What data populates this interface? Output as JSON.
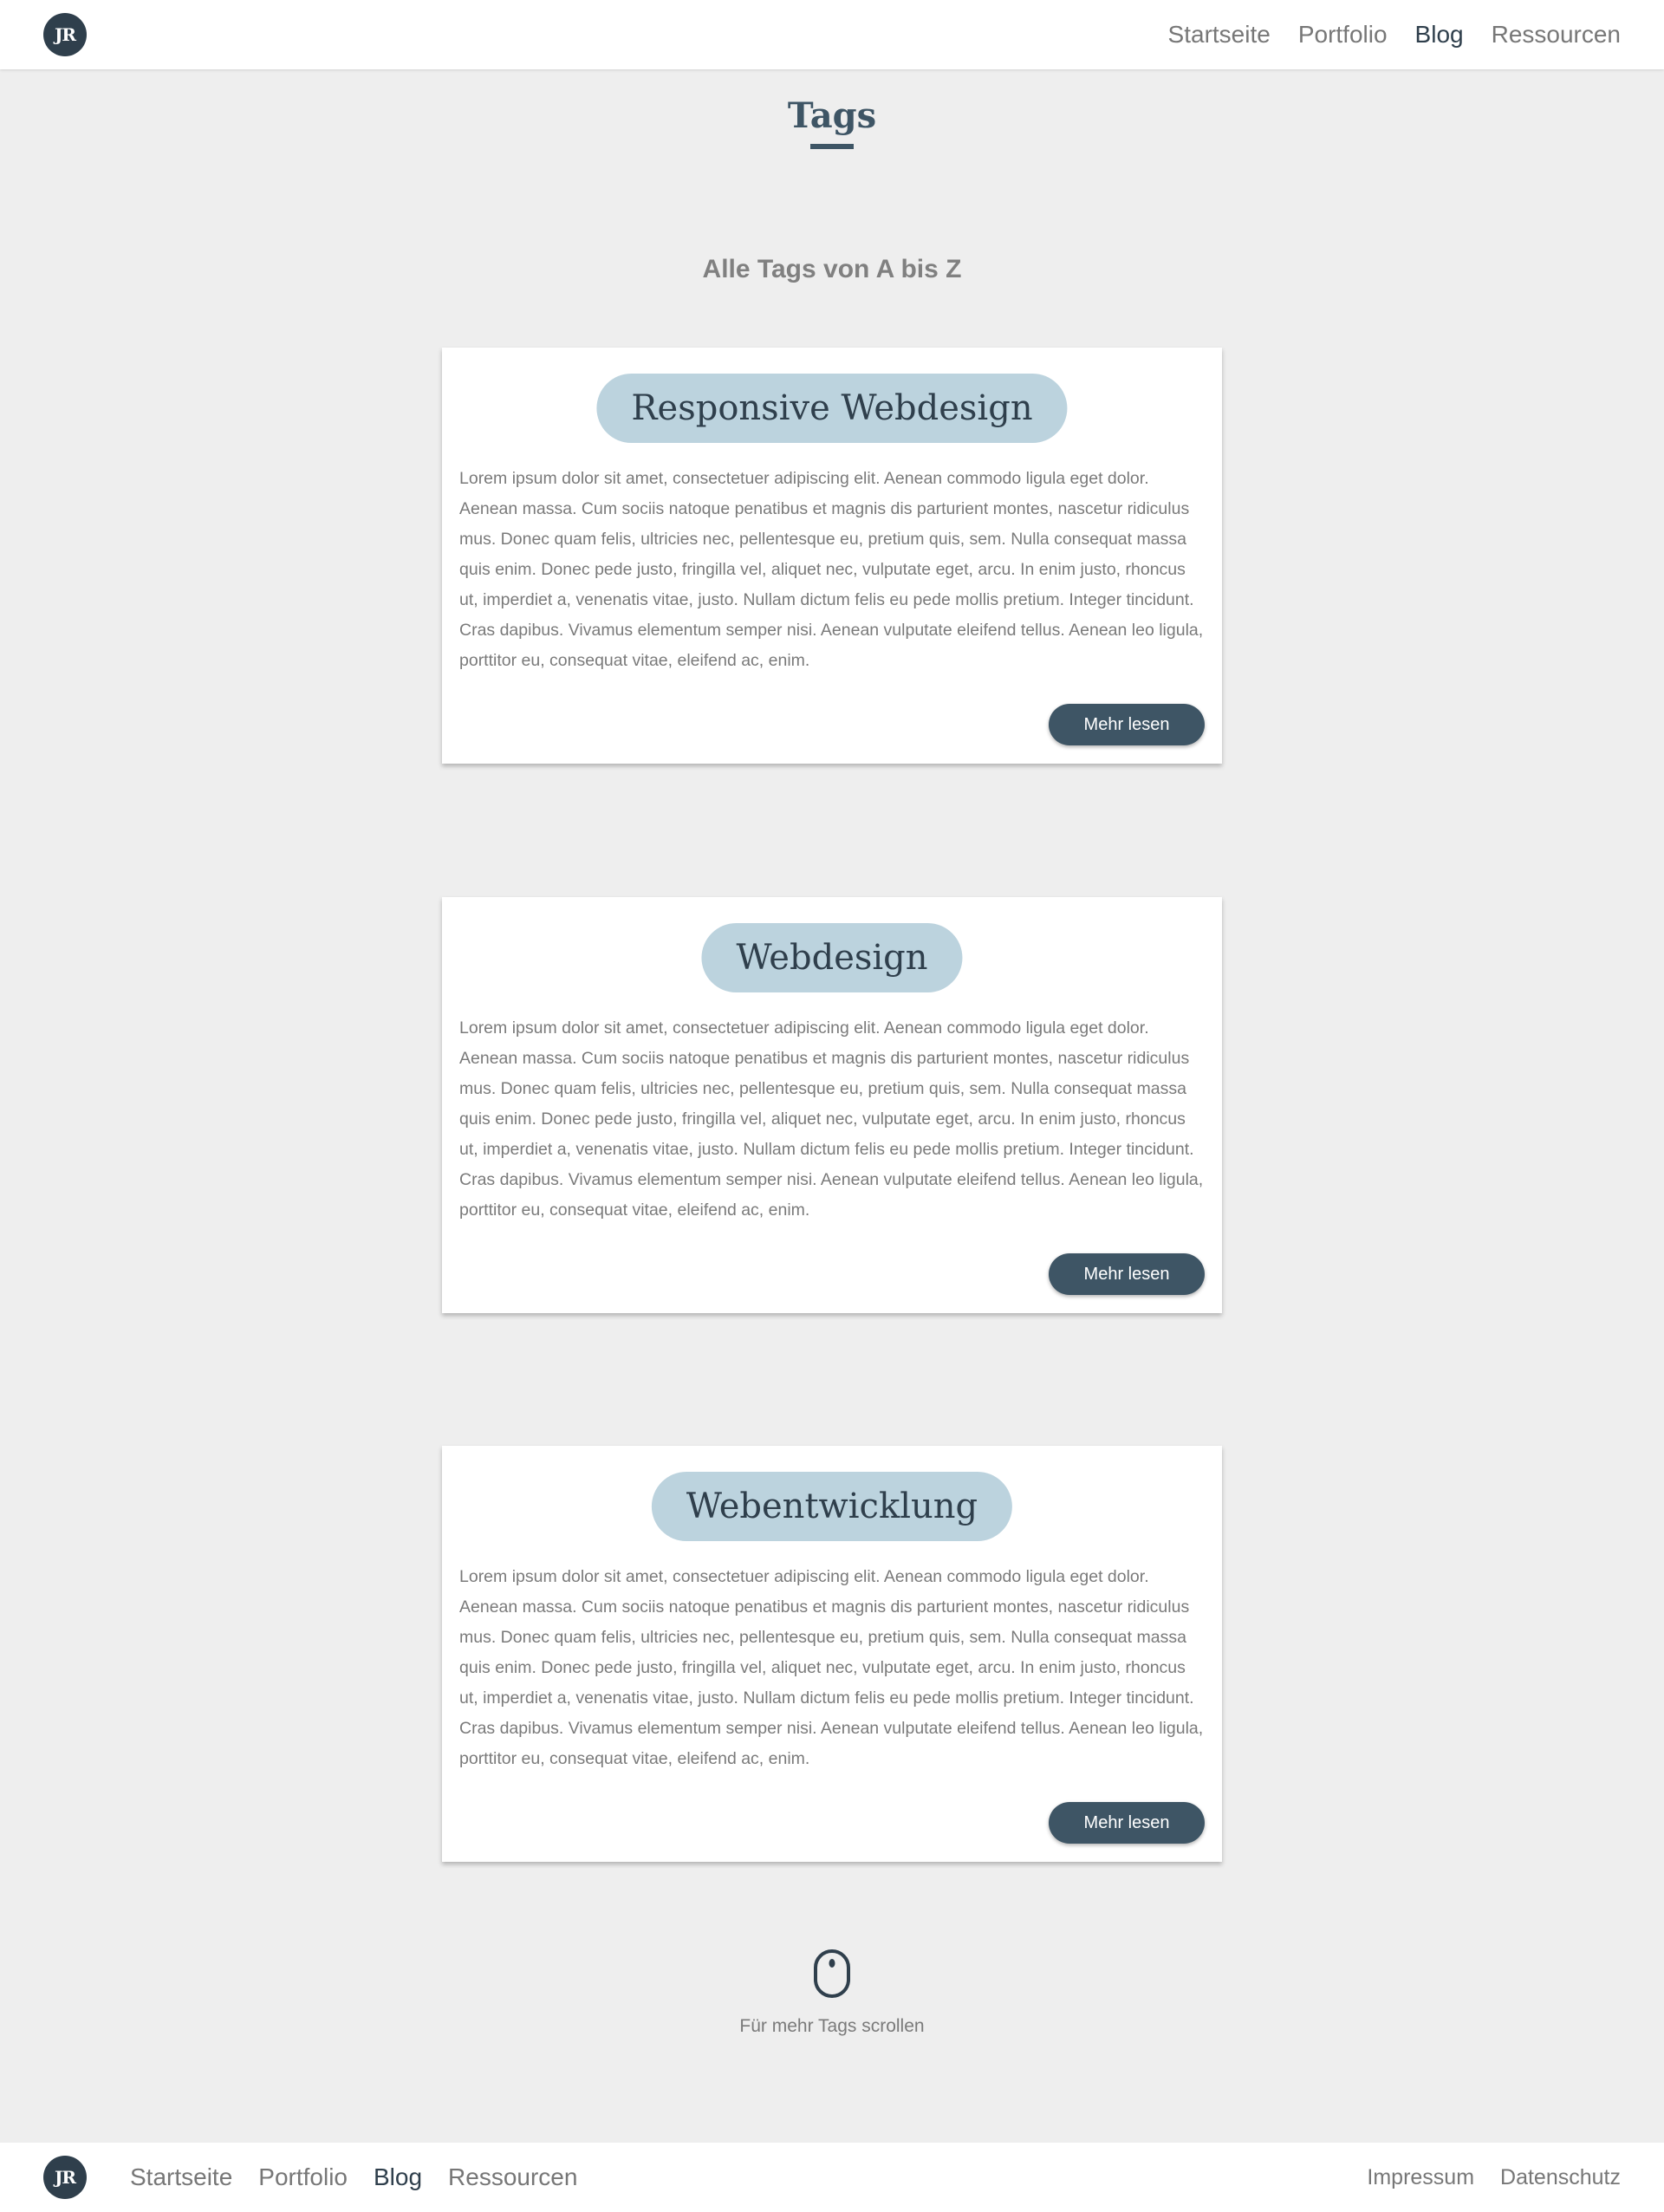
{
  "header": {
    "logo_text": "JR",
    "nav": [
      {
        "label": "Startseite"
      },
      {
        "label": "Portfolio"
      },
      {
        "label": "Blog"
      },
      {
        "label": "Ressourcen"
      }
    ],
    "active_nav": "Blog"
  },
  "page": {
    "title": "Tags",
    "subtitle": "Alle Tags von A bis Z"
  },
  "cards": [
    {
      "tag": "Responsive Webdesign",
      "excerpt": "Lorem ipsum dolor sit amet, consectetuer adipiscing elit. Aenean commodo ligula eget dolor. Aenean massa. Cum sociis natoque penatibus et magnis dis parturient montes, nascetur ridiculus mus. Donec quam felis, ultricies nec, pellentesque eu, pretium quis, sem. Nulla consequat massa quis enim. Donec pede justo, fringilla vel, aliquet nec, vulputate eget, arcu. In enim justo, rhoncus ut, imperdiet a, venenatis vitae, justo. Nullam dictum felis eu pede mollis pretium. Integer tincidunt. Cras dapibus. Vivamus elementum semper nisi. Aenean vulputate eleifend tellus. Aenean leo ligula, porttitor eu, consequat vitae, eleifend ac, enim.",
      "button": "Mehr lesen"
    },
    {
      "tag": "Webdesign",
      "excerpt": "Lorem ipsum dolor sit amet, consectetuer adipiscing elit. Aenean commodo ligula eget dolor. Aenean massa. Cum sociis natoque penatibus et magnis dis parturient montes, nascetur ridiculus mus. Donec quam felis, ultricies nec, pellentesque eu, pretium quis, sem. Nulla consequat massa quis enim. Donec pede justo, fringilla vel, aliquet nec, vulputate eget, arcu. In enim justo, rhoncus ut, imperdiet a, venenatis vitae, justo. Nullam dictum felis eu pede mollis pretium. Integer tincidunt. Cras dapibus. Vivamus elementum semper nisi. Aenean vulputate eleifend tellus. Aenean leo ligula, porttitor eu, consequat vitae, eleifend ac, enim.",
      "button": "Mehr lesen"
    },
    {
      "tag": "Webentwicklung",
      "excerpt": "Lorem ipsum dolor sit amet, consectetuer adipiscing elit. Aenean commodo ligula eget dolor. Aenean massa. Cum sociis natoque penatibus et magnis dis parturient montes, nascetur ridiculus mus. Donec quam felis, ultricies nec, pellentesque eu, pretium quis, sem. Nulla consequat massa quis enim. Donec pede justo, fringilla vel, aliquet nec, vulputate eget, arcu. In enim justo, rhoncus ut, imperdiet a, venenatis vitae, justo. Nullam dictum felis eu pede mollis pretium. Integer tincidunt. Cras dapibus. Vivamus elementum semper nisi. Aenean vulputate eleifend tellus. Aenean leo ligula, porttitor eu, consequat vitae, eleifend ac, enim.",
      "button": "Mehr lesen"
    }
  ],
  "scroll_hint": {
    "icon": "mouse-icon",
    "text": "Für mehr Tags scrollen"
  },
  "footer": {
    "logo_text": "JR",
    "nav": [
      {
        "label": "Startseite"
      },
      {
        "label": "Portfolio"
      },
      {
        "label": "Blog"
      },
      {
        "label": "Ressourcen"
      }
    ],
    "legal": [
      {
        "label": "Impressum"
      },
      {
        "label": "Datenschutz"
      }
    ]
  },
  "colors": {
    "primary": "#3e5565",
    "dark": "#2f3f4c",
    "tag_pill": "#bcd3de",
    "background": "#eeeeee",
    "muted_text": "#7a7a7a"
  }
}
